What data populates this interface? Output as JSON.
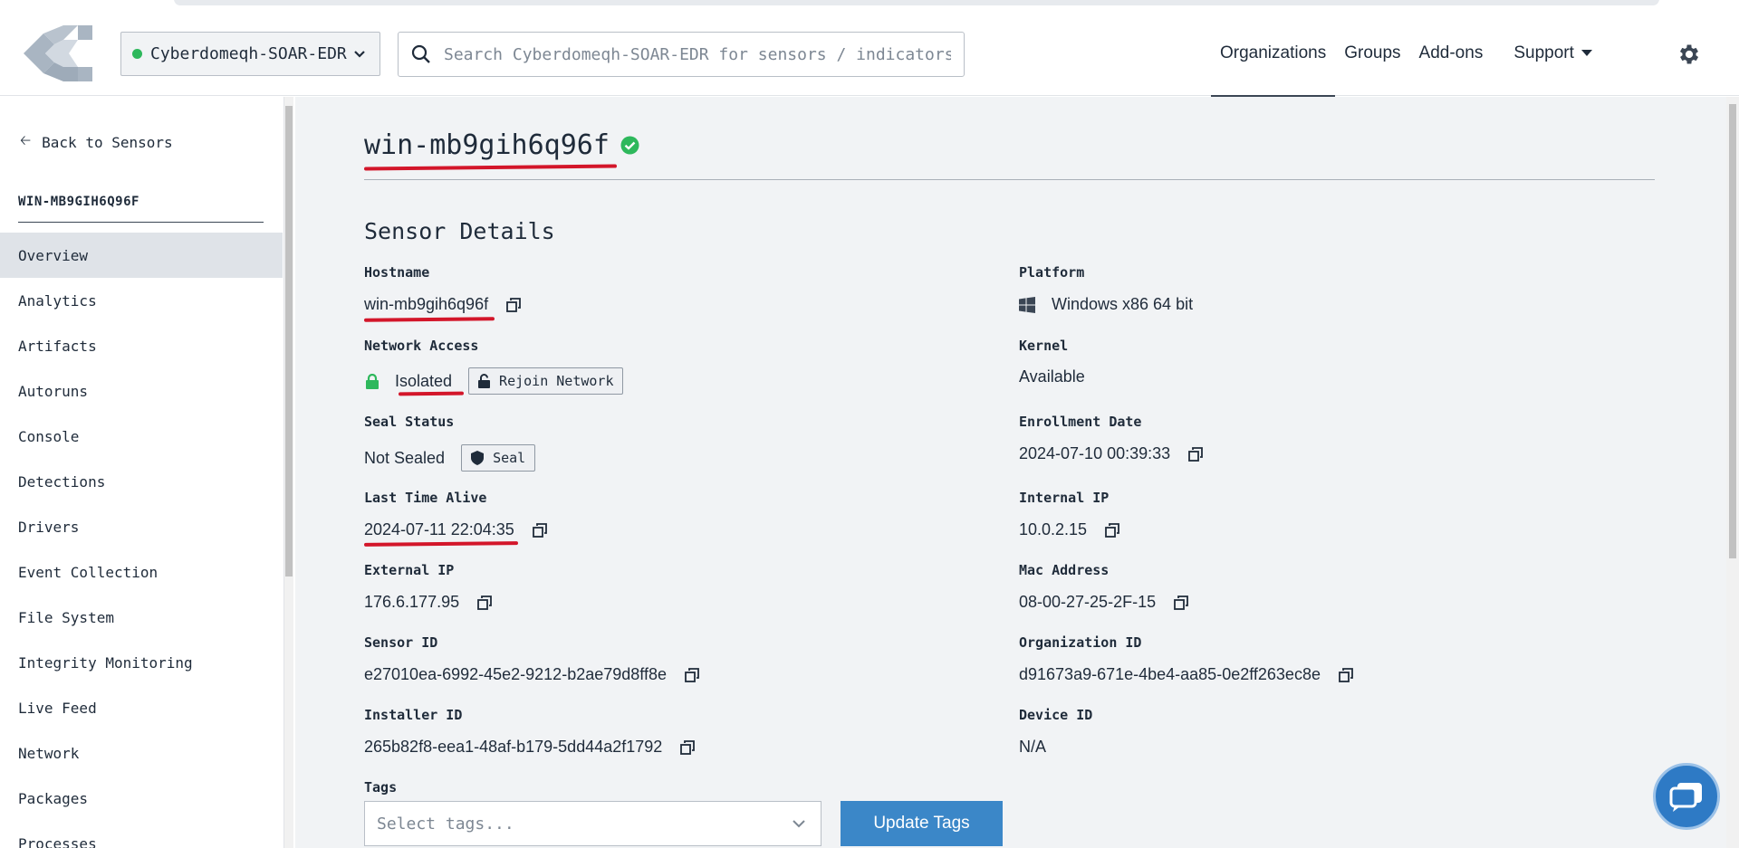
{
  "header": {
    "org_selector": {
      "label": "Cyberdomeqh-SOAR-EDR",
      "status_color": "#2eb85c"
    },
    "search": {
      "placeholder": "Search Cyberdomeqh-SOAR-EDR for sensors / indicators..."
    },
    "nav": [
      {
        "label": "Organizations",
        "active": true
      },
      {
        "label": "Groups",
        "active": false
      },
      {
        "label": "Add-ons",
        "active": false
      }
    ],
    "support_label": "Support"
  },
  "sidebar": {
    "back_label": "Back to Sensors",
    "sensor_title": "WIN-MB9GIH6Q96F",
    "items": [
      {
        "label": "Overview",
        "active": true
      },
      {
        "label": "Analytics"
      },
      {
        "label": "Artifacts"
      },
      {
        "label": "Autoruns"
      },
      {
        "label": "Console"
      },
      {
        "label": "Detections"
      },
      {
        "label": "Drivers"
      },
      {
        "label": "Event Collection"
      },
      {
        "label": "File System"
      },
      {
        "label": "Integrity Monitoring"
      },
      {
        "label": "Live Feed"
      },
      {
        "label": "Network"
      },
      {
        "label": "Packages"
      },
      {
        "label": "Processes"
      }
    ]
  },
  "main": {
    "title": "win-mb9gih6q96f",
    "section_title": "Sensor Details",
    "fields": {
      "hostname": {
        "label": "Hostname",
        "value": "win-mb9gih6q96f"
      },
      "platform": {
        "label": "Platform",
        "value": "Windows x86 64 bit"
      },
      "network_access": {
        "label": "Network Access",
        "value": "Isolated",
        "button": "Rejoin Network"
      },
      "kernel": {
        "label": "Kernel",
        "value": "Available"
      },
      "seal_status": {
        "label": "Seal Status",
        "value": "Not Sealed",
        "button": "Seal"
      },
      "enrollment_date": {
        "label": "Enrollment Date",
        "value": "2024-07-10 00:39:33"
      },
      "last_time_alive": {
        "label": "Last Time Alive",
        "value": "2024-07-11 22:04:35"
      },
      "internal_ip": {
        "label": "Internal IP",
        "value": "10.0.2.15"
      },
      "external_ip": {
        "label": "External IP",
        "value": "176.6.177.95"
      },
      "mac_address": {
        "label": "Mac Address",
        "value": "08-00-27-25-2F-15"
      },
      "sensor_id": {
        "label": "Sensor ID",
        "value": "e27010ea-6992-45e2-9212-b2ae79d8ff8e"
      },
      "organization_id": {
        "label": "Organization ID",
        "value": "d91673a9-671e-4be4-aa85-0e2ff263ec8e"
      },
      "installer_id": {
        "label": "Installer ID",
        "value": "265b82f8-eea1-48af-b179-5dd44a2f1792"
      },
      "device_id": {
        "label": "Device ID",
        "value": "N/A"
      }
    },
    "tags": {
      "label": "Tags",
      "placeholder": "Select tags...",
      "button": "Update Tags"
    }
  },
  "colors": {
    "accent": "#3b87c8",
    "online": "#2eb85c",
    "annotation": "#d3162a"
  }
}
